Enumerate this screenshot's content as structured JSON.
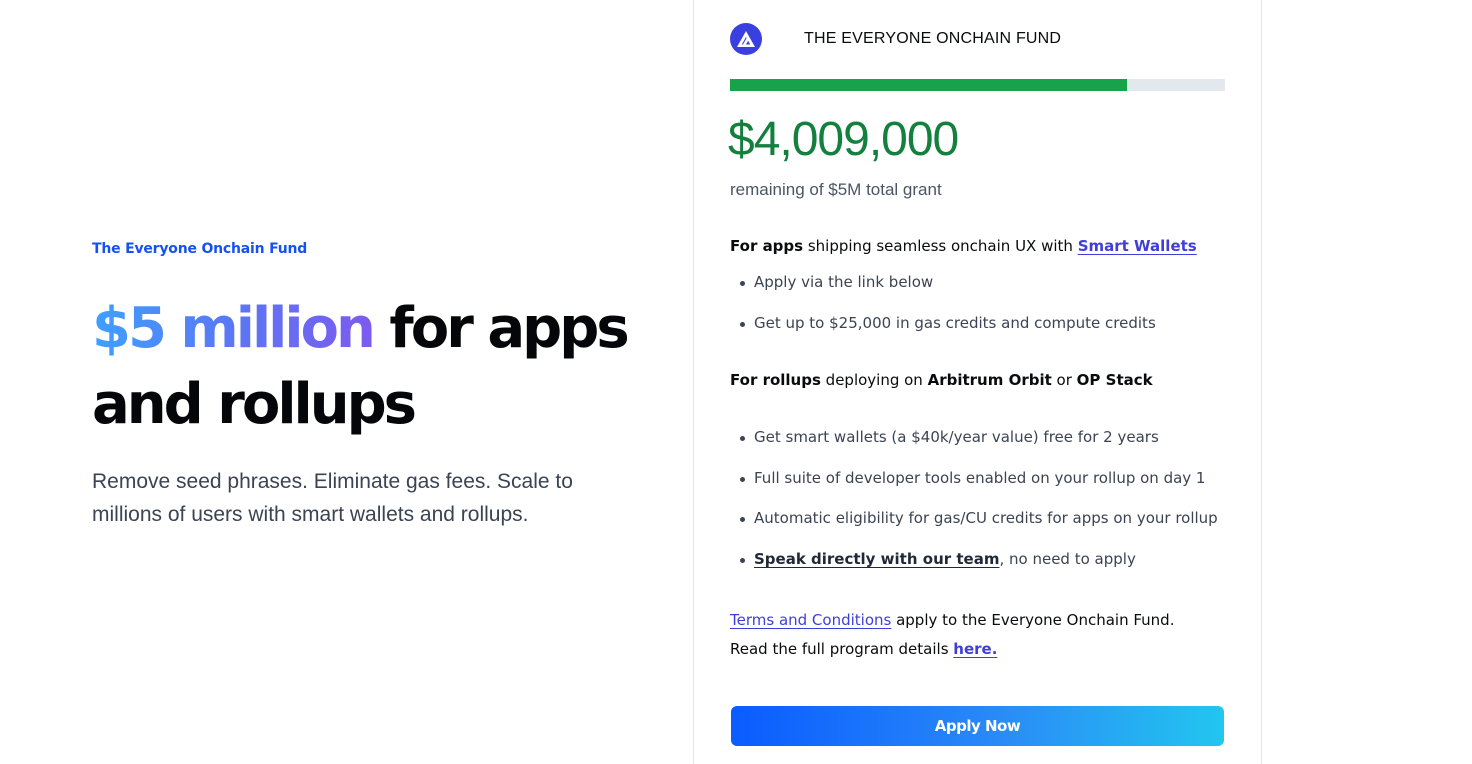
{
  "hero": {
    "eyebrow": "The Everyone Onchain Fund",
    "headline_highlight": "$5 million",
    "headline_rest": " for apps and rollups",
    "subtext": "Remove seed phrases. Eliminate gas fees. Scale to millions of users with smart wallets and rollups."
  },
  "card": {
    "logo_icon": "triangle-logo-icon",
    "title": "THE EVERYONE ONCHAIN FUND",
    "progress_fraction": 0.802,
    "amount": "$4,009,000",
    "amount_caption": "remaining of $5M total grant",
    "apps": {
      "lead_bold": "For apps",
      "lead_text": " shipping seamless onchain UX with ",
      "lead_link": "Smart Wallets",
      "bullets": [
        "Apply via the link below",
        "Get up to $25,000 in gas credits and compute credits"
      ]
    },
    "rollups": {
      "lead_bold": "For rollups",
      "lead_text": " deploying on ",
      "lead_bold2": "Arbitrum Orbit",
      "lead_or": " or ",
      "lead_bold3": "OP Stack",
      "bullets": [
        "Get smart wallets (a $40k/year value) free for 2 years",
        "Full suite of developer tools enabled on your rollup on day 1",
        "Automatic eligibility for gas/CU credits for apps on your rollup"
      ],
      "last_bullet_link": "Speak directly with our team",
      "last_bullet_rest": ", no need to apply"
    },
    "terms": {
      "link": "Terms and Conditions",
      "rest": " apply to the Everyone Onchain Fund.",
      "details_text": "Read the full program details ",
      "details_link": "here."
    },
    "apply_label": "Apply Now"
  },
  "colors": {
    "accent_blue": "#1652f0",
    "amount_green": "#13803d",
    "progress_green": "#16a34a",
    "link_indigo": "#3f3fd6"
  }
}
